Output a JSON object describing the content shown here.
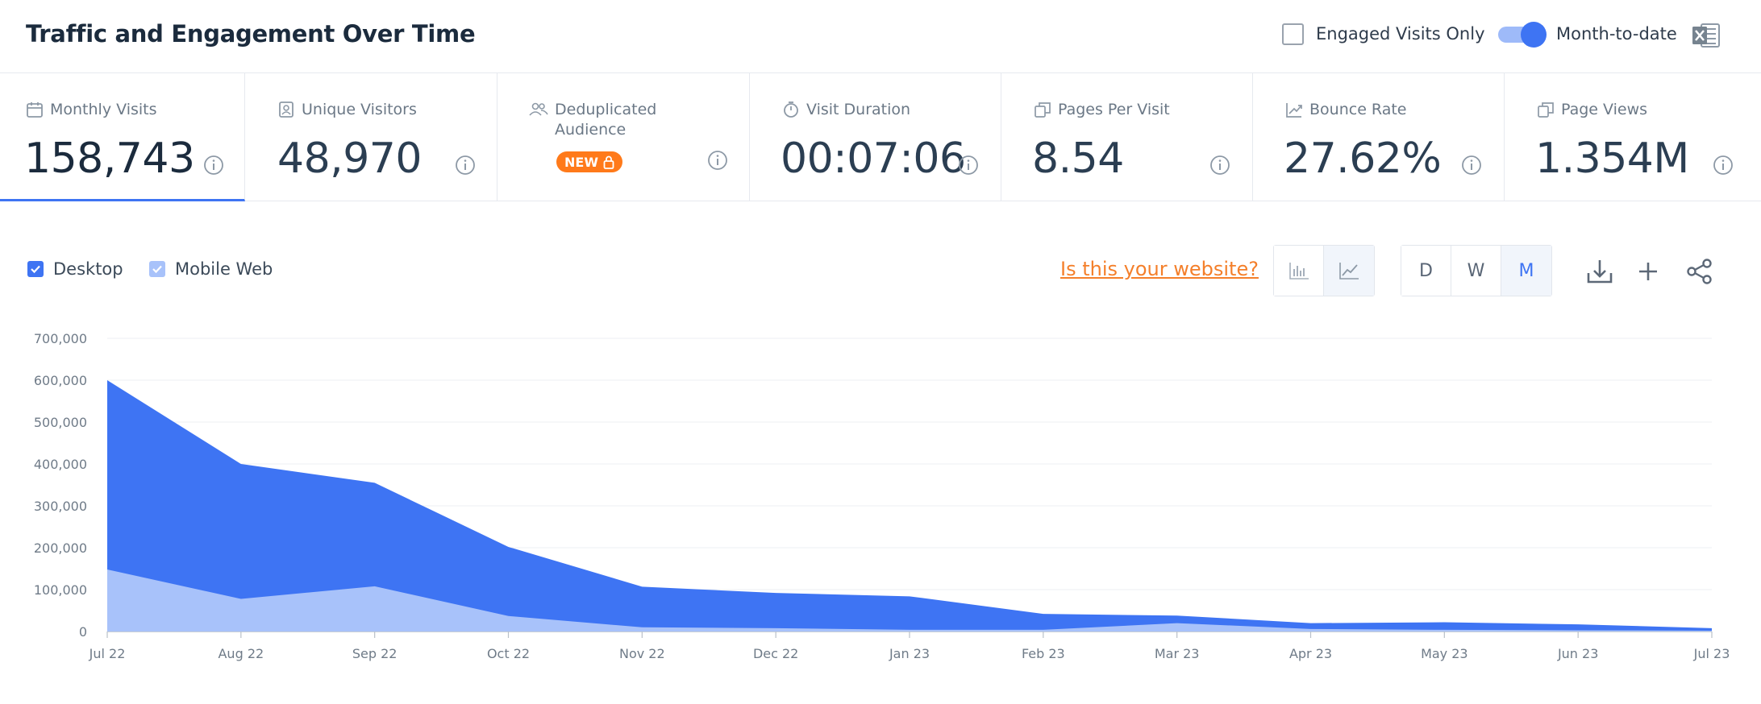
{
  "header": {
    "title": "Traffic and Engagement Over Time",
    "engaged_label": "Engaged Visits Only",
    "month_to_date_label": "Month-to-date",
    "excel_icon": "excel-icon"
  },
  "metrics": [
    {
      "label": "Monthly Visits",
      "value": "158,743",
      "icon": "calendar-icon"
    },
    {
      "label": "Unique Visitors",
      "value": "48,970",
      "icon": "visitor-badge-icon"
    },
    {
      "label": "Deduplicated Audience",
      "value": "",
      "badge": "NEW",
      "icon": "users-icon"
    },
    {
      "label": "Visit Duration",
      "value": "00:07:06",
      "icon": "stopwatch-icon"
    },
    {
      "label": "Pages Per Visit",
      "value": "8.54",
      "icon": "pages-icon"
    },
    {
      "label": "Bounce Rate",
      "value": "27.62%",
      "icon": "trend-icon"
    },
    {
      "label": "Page Views",
      "value": "1.354M",
      "icon": "pages-icon"
    }
  ],
  "legend": {
    "desktop": "Desktop",
    "mobile": "Mobile Web"
  },
  "website_link": "Is this your website?",
  "granularity": [
    "D",
    "W",
    "M"
  ],
  "granularity_selected": "M",
  "colors": {
    "accent": "#3e74f3",
    "desktop": "#3e74f3",
    "mobile": "#a8c2fa",
    "orange": "#f47f2a"
  },
  "chart_data": {
    "type": "area",
    "stacked": true,
    "categories": [
      "Jul 22",
      "Aug 22",
      "Sep 22",
      "Oct 22",
      "Nov 22",
      "Dec 22",
      "Jan 23",
      "Feb 23",
      "Mar 23",
      "Apr 23",
      "May 23",
      "Jun 23",
      "Jul 23"
    ],
    "series": [
      {
        "name": "Mobile Web",
        "values": [
          148000,
          78000,
          108000,
          37000,
          10000,
          8000,
          4000,
          4000,
          20000,
          6000,
          4000,
          3000,
          2000
        ]
      },
      {
        "name": "Desktop",
        "values": [
          452000,
          322000,
          247000,
          165000,
          97000,
          84000,
          80000,
          38000,
          18000,
          14000,
          18000,
          14000,
          6000
        ]
      }
    ],
    "y_ticks": [
      "0",
      "100,000",
      "200,000",
      "300,000",
      "400,000",
      "500,000",
      "600,000",
      "700,000"
    ],
    "ylim": [
      0,
      700000
    ],
    "grid": true
  }
}
